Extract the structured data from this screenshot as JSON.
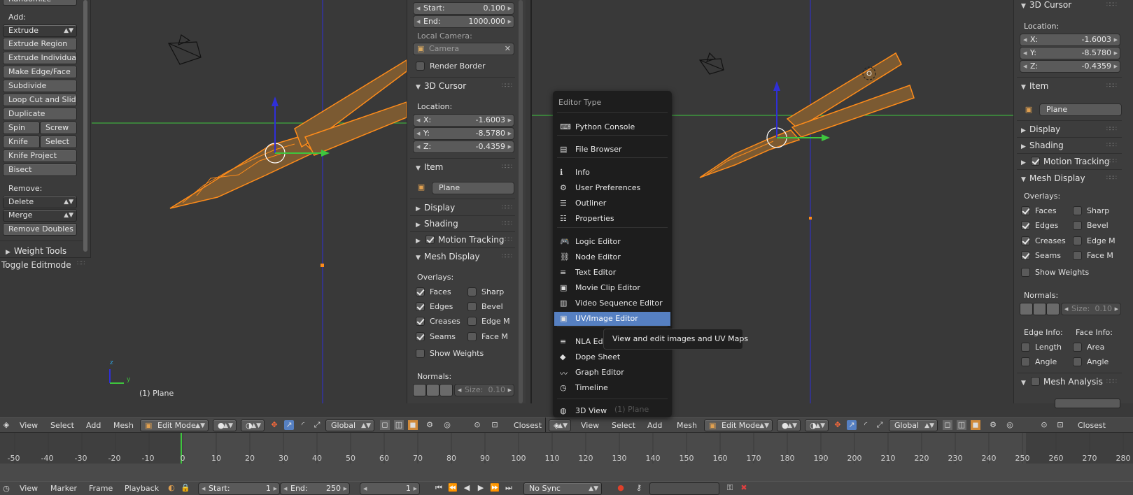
{
  "left_toolshelf": {
    "randomize": "Randomize",
    "add_label": "Add:",
    "extrude": "Extrude",
    "buttons": [
      "Extrude Region",
      "Extrude Individual",
      "Make Edge/Face",
      "Subdivide",
      "Loop Cut and Slide",
      "Duplicate"
    ],
    "spin": "Spin",
    "screw": "Screw",
    "knife": "Knife",
    "select": "Select",
    "knife_project": "Knife Project",
    "bisect": "Bisect",
    "remove_label": "Remove:",
    "delete": "Delete",
    "merge": "Merge",
    "remove_doubles": "Remove Doubles",
    "weight_tools": "Weight Tools",
    "toggle_editmode": "Toggle Editmode"
  },
  "viewport_left": {
    "object_label": "(1) Plane",
    "axis_y": "y",
    "axis_z": "z"
  },
  "props_mid": {
    "start_label": "Start:",
    "start_value": "0.100",
    "end_label": "End:",
    "end_value": "1000.000",
    "local_camera": "Local Camera:",
    "camera": "Camera",
    "render_border": "Render Border",
    "cursor_title": "3D Cursor",
    "location": "Location:",
    "x_label": "X:",
    "x_value": "-1.6003",
    "y_label": "Y:",
    "y_value": "-8.5780",
    "z_label": "Z:",
    "z_value": "-0.4359",
    "item_title": "Item",
    "item_name": "Plane",
    "display": "Display",
    "shading": "Shading",
    "motion_tracking": "Motion Tracking",
    "mesh_display": "Mesh Display",
    "overlays": "Overlays:",
    "faces": "Faces",
    "sharp": "Sharp",
    "edges": "Edges",
    "bevel": "Bevel",
    "creases": "Creases",
    "edge_m": "Edge M",
    "seams": "Seams",
    "face_m": "Face M",
    "show_weights": "Show Weights",
    "normals": "Normals:",
    "size_label": "Size:",
    "size_value": "0.10"
  },
  "props_right": {
    "cursor_title": "3D Cursor",
    "location": "Location:",
    "x_label": "X:",
    "x_value": "-1.6003",
    "y_label": "Y:",
    "y_value": "-8.5780",
    "z_label": "Z:",
    "z_value": "-0.4359",
    "item_title": "Item",
    "item_name": "Plane",
    "display": "Display",
    "shading": "Shading",
    "motion_tracking": "Motion Tracking",
    "mesh_display": "Mesh Display",
    "overlays": "Overlays:",
    "faces": "Faces",
    "sharp": "Sharp",
    "edges": "Edges",
    "bevel": "Bevel",
    "creases": "Creases",
    "edge_m": "Edge M",
    "seams": "Seams",
    "face_m": "Face M",
    "show_weights": "Show Weights",
    "normals": "Normals:",
    "size_label": "Size:",
    "size_value": "0.10",
    "edge_info": "Edge Info:",
    "face_info": "Face Info:",
    "length": "Length",
    "area": "Area",
    "angle": "Angle",
    "angle2": "Angle",
    "mesh_analysis": "Mesh Analysis"
  },
  "editor_menu": {
    "title": "Editor Type",
    "items": [
      "Python Console",
      "File Browser",
      "Info",
      "User Preferences",
      "Outliner",
      "Properties",
      "Logic Editor",
      "Node Editor",
      "Text Editor",
      "Movie Clip Editor",
      "Video Sequence Editor",
      "UV/Image Editor",
      "NLA Editor",
      "Dope Sheet",
      "Graph Editor",
      "Timeline",
      "3D View"
    ],
    "tooltip": "View and edit images and UV Maps",
    "behind_text": "(1) Plane"
  },
  "header_left": {
    "view": "View",
    "select": "Select",
    "add": "Add",
    "mesh": "Mesh",
    "mode": "Edit Mode",
    "orientation": "Global",
    "snap": "Closest"
  },
  "header_right": {
    "view": "View",
    "select": "Select",
    "add": "Add",
    "mesh": "Mesh",
    "mode": "Edit Mode",
    "orientation": "Global",
    "snap": "Closest"
  },
  "timeline": {
    "ticks": [
      "-50",
      "-40",
      "-30",
      "-20",
      "-10",
      "0",
      "10",
      "20",
      "30",
      "40",
      "50",
      "60",
      "70",
      "80",
      "90",
      "100",
      "110",
      "120",
      "130",
      "140",
      "150",
      "160",
      "170",
      "180",
      "190",
      "200",
      "210",
      "220",
      "230",
      "240",
      "250",
      "260",
      "270",
      "280"
    ],
    "view": "View",
    "marker": "Marker",
    "frame": "Frame",
    "playback": "Playback",
    "start_label": "Start:",
    "start_value": "1",
    "end_label": "End:",
    "end_value": "250",
    "current_frame": "1",
    "sync": "No Sync"
  },
  "colors": {
    "mesh_orange": "#ff8c1a",
    "menu_highlight": "#5680c2",
    "axis_green": "#3ec63e",
    "axis_blue": "#2f2fd8"
  }
}
